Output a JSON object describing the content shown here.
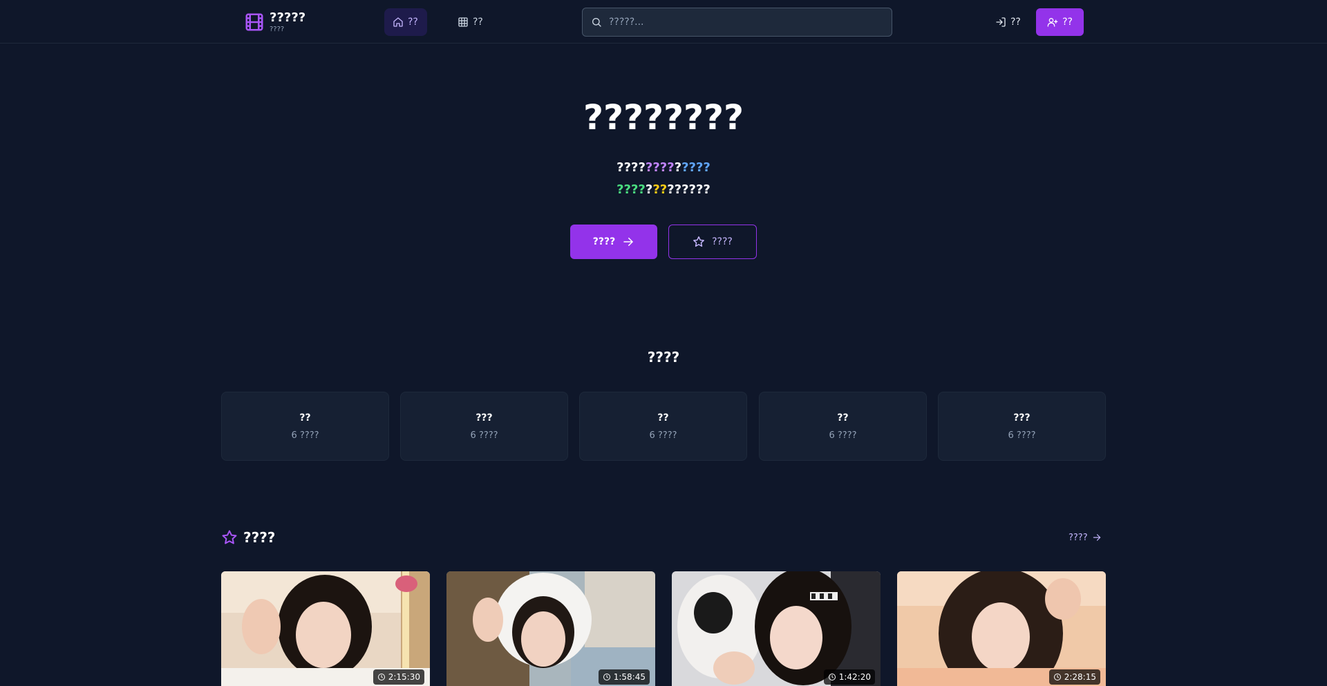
{
  "header": {
    "brand_title": "?????",
    "brand_subtitle": "????",
    "nav": {
      "home": "??",
      "categories": "??"
    },
    "search_placeholder": "?????...",
    "login": "??",
    "register": "??"
  },
  "hero": {
    "title": "????????",
    "line1": [
      {
        "text": "????",
        "color": "white"
      },
      {
        "text": "????",
        "color": "purple"
      },
      {
        "text": "?",
        "color": "white"
      },
      {
        "text": "????",
        "color": "blue"
      }
    ],
    "line2": [
      {
        "text": "????",
        "color": "green"
      },
      {
        "text": "?",
        "color": "white"
      },
      {
        "text": "??",
        "color": "yellow"
      },
      {
        "text": "??????",
        "color": "white"
      }
    ],
    "primary_button": "????",
    "secondary_button": "????"
  },
  "categories": {
    "title": "????",
    "items": [
      {
        "name": "??",
        "count": "6 ????"
      },
      {
        "name": "???",
        "count": "6 ????"
      },
      {
        "name": "??",
        "count": "6 ????"
      },
      {
        "name": "??",
        "count": "6 ????"
      },
      {
        "name": "???",
        "count": "6 ????"
      }
    ]
  },
  "featured": {
    "title": "????",
    "view_all": "????",
    "videos": [
      {
        "duration": "2:15:30"
      },
      {
        "duration": "1:58:45"
      },
      {
        "duration": "1:42:20"
      },
      {
        "duration": "2:28:15"
      }
    ]
  },
  "colors": {
    "background": "#0f172a",
    "accent": "#9333ea",
    "accent_light": "#c4b5fd"
  }
}
